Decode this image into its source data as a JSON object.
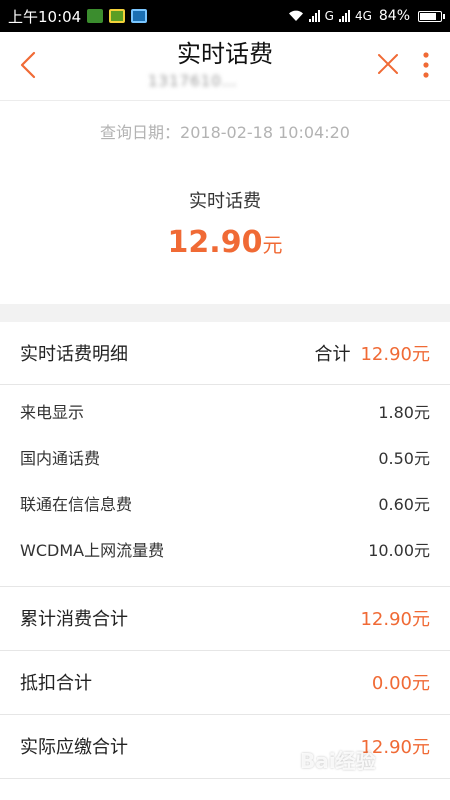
{
  "status_bar": {
    "time": "上午10:04",
    "network": "G",
    "network2": "4G",
    "battery": "84%",
    "battery_level": 0.84
  },
  "header": {
    "title": "实时话费",
    "phone_masked": "1317610…",
    "back_icon": "chevron-left-icon",
    "close_icon": "close-icon",
    "more_icon": "more-vertical-icon",
    "accent": "#f06a35"
  },
  "summary": {
    "query_date": "查询日期：2018-02-18 10:04:20",
    "label": "实时话费",
    "amount": "12.90",
    "unit": "元"
  },
  "detail": {
    "header_label": "实时话费明细",
    "total_label": "合计",
    "total_value": "12.90元",
    "items": [
      {
        "label": "来电显示",
        "value": "1.80元"
      },
      {
        "label": "国内通话费",
        "value": "0.50元"
      },
      {
        "label": "联通在信信息费",
        "value": "0.60元"
      },
      {
        "label": "WCDMA上网流量费",
        "value": "10.00元"
      }
    ],
    "summary_rows": [
      {
        "label": "累计消费合计",
        "value": "12.90元"
      },
      {
        "label": "抵扣合计",
        "value": "0.00元"
      },
      {
        "label": "实际应缴合计",
        "value": "12.90元"
      }
    ]
  },
  "watermark": "Bai经验"
}
